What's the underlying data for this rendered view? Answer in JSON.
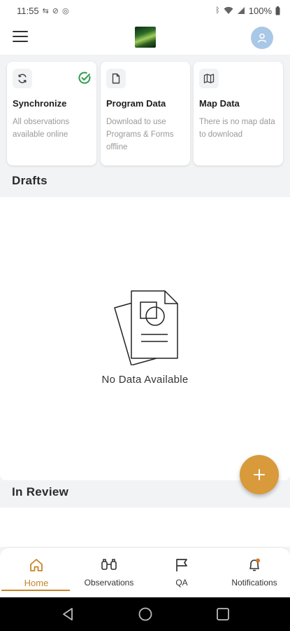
{
  "status_bar": {
    "time": "11:55",
    "battery": "100%"
  },
  "app_bar": {
    "menu_icon": "hamburger-menu-icon",
    "logo": "app-logo",
    "avatar_icon": "user-icon"
  },
  "cards": [
    {
      "icon": "sync-icon",
      "title": "Synchronize",
      "description": "All observations available online",
      "status_icon": "check-circle-icon",
      "status_color": "#2e9e4a"
    },
    {
      "icon": "document-icon",
      "title": "Program Data",
      "description": "Download to use Programs & Forms offline"
    },
    {
      "icon": "map-icon",
      "title": "Map Data",
      "description": "There is no map data to download"
    }
  ],
  "drafts": {
    "title": "Drafts",
    "empty_text": "No Data Available"
  },
  "in_review": {
    "title": "In Review"
  },
  "fab": {
    "icon": "plus-icon",
    "color": "#d89a3a"
  },
  "bottom_nav": {
    "active_color": "#c5852b",
    "items": [
      {
        "label": "Home",
        "icon": "home-icon",
        "active": true
      },
      {
        "label": "Observations",
        "icon": "binoculars-icon",
        "active": false
      },
      {
        "label": "QA",
        "icon": "flag-icon",
        "active": false
      },
      {
        "label": "Notifications",
        "icon": "bell-icon",
        "active": false
      }
    ]
  }
}
